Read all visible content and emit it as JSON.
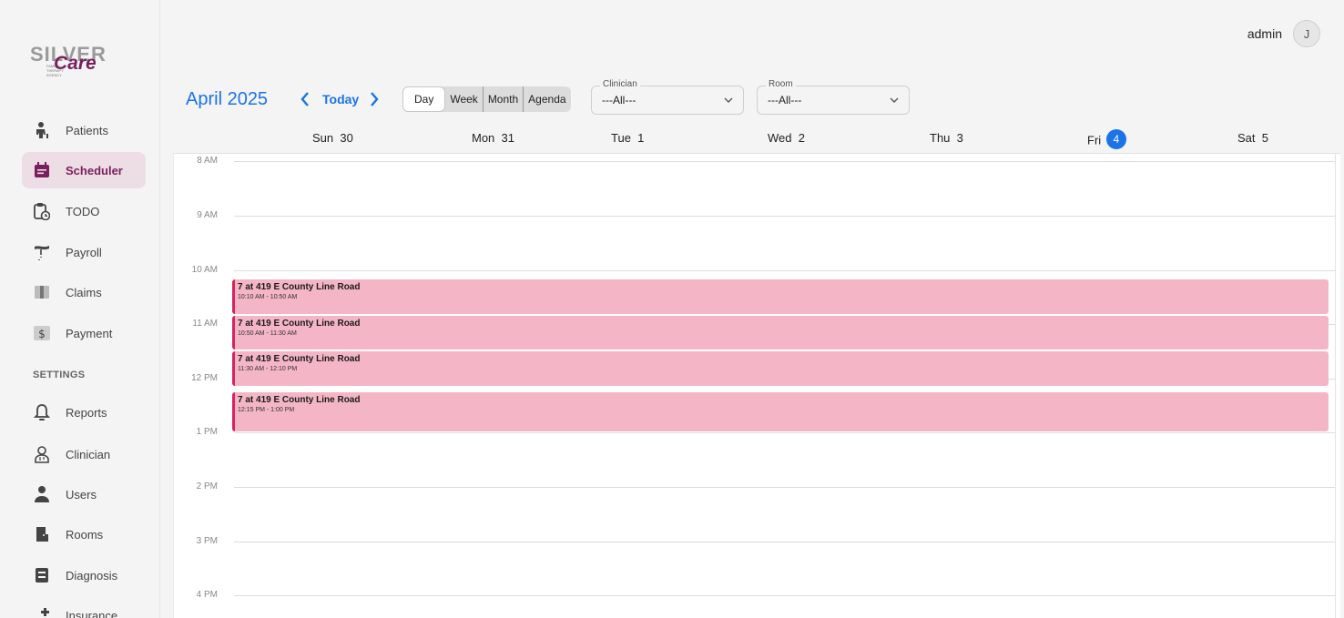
{
  "sidebar": {
    "logo": {
      "silver": "SILVER",
      "care": "Care",
      "tagline": "FAMILY THERAPY AGENCY"
    },
    "items": [
      {
        "label": "Patients",
        "icon": "patients-icon"
      },
      {
        "label": "Scheduler",
        "icon": "calendar-icon",
        "active": true
      },
      {
        "label": "TODO",
        "icon": "clipboard-clock-icon"
      },
      {
        "label": "Payroll",
        "icon": "money-hand-icon"
      },
      {
        "label": "Claims",
        "icon": "file-icon"
      },
      {
        "label": "Payment",
        "icon": "dollar-icon"
      }
    ],
    "settings_header": "SETTINGS",
    "settings_items": [
      {
        "label": "Reports",
        "icon": "bell-icon"
      },
      {
        "label": "Clinician",
        "icon": "doctor-icon"
      },
      {
        "label": "Users",
        "icon": "user-icon"
      },
      {
        "label": "Rooms",
        "icon": "door-icon"
      },
      {
        "label": "Diagnosis",
        "icon": "diagnosis-icon"
      },
      {
        "label": "Insurance",
        "icon": "insurance-icon"
      }
    ]
  },
  "header": {
    "user_name": "admin",
    "avatar_initial": "J"
  },
  "toolbar": {
    "month_title": "April 2025",
    "prev": "‹",
    "next": "›",
    "today": "Today",
    "views": [
      "Day",
      "Week",
      "Month",
      "Agenda"
    ],
    "active_view": "Day",
    "clinician": {
      "label": "Clinician",
      "value": "---All---"
    },
    "room": {
      "label": "Room",
      "value": "---All---"
    }
  },
  "calendar": {
    "days": [
      {
        "dow": "Sun",
        "date": "30"
      },
      {
        "dow": "Mon",
        "date": "31"
      },
      {
        "dow": "Tue",
        "date": "1"
      },
      {
        "dow": "Wed",
        "date": "2"
      },
      {
        "dow": "Thu",
        "date": "3"
      },
      {
        "dow": "Fri",
        "date": "4",
        "today": true
      },
      {
        "dow": "Sat",
        "date": "5"
      }
    ],
    "hours": [
      "8 AM",
      "9 AM",
      "10 AM",
      "11 AM",
      "12 PM",
      "1 PM",
      "2 PM",
      "3 PM",
      "4 PM"
    ],
    "events": [
      {
        "title": "7 at 419 E County Line Road",
        "time": "10:10 AM - 10:50 AM"
      },
      {
        "title": "7 at 419 E County Line Road",
        "time": "10:50 AM - 11:30 AM"
      },
      {
        "title": "7 at 419 E County Line Road",
        "time": "11:30 AM - 12:10 PM"
      },
      {
        "title": "7 at 419 E County Line Road",
        "time": "12:15 PM - 1:00 PM"
      }
    ]
  },
  "colors": {
    "accent": "#1a73e8",
    "brand": "#7a1f5e",
    "event_bg": "#f4b6c6",
    "event_border": "#d6245a"
  }
}
